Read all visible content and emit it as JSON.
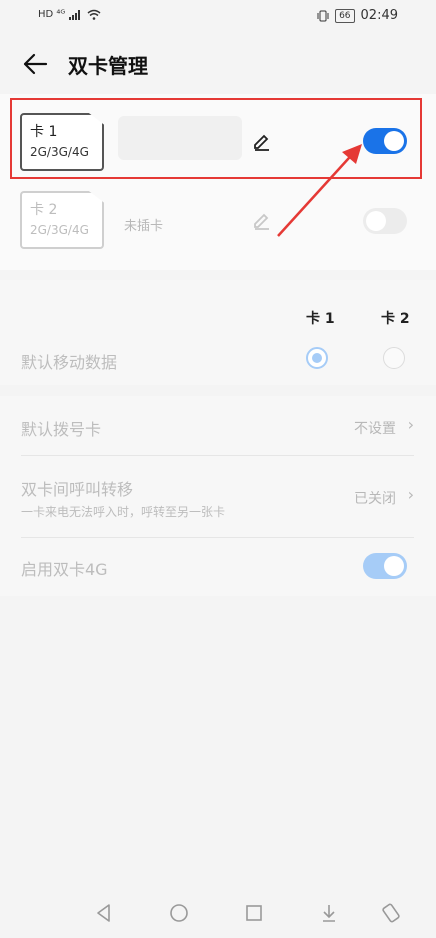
{
  "status_bar": {
    "left_indicators": "HD ⁴ᴳ",
    "battery": "66",
    "time": "02:49"
  },
  "header": {
    "title": "双卡管理"
  },
  "sim1": {
    "name": "卡 1",
    "type": "2G/3G/4G",
    "enabled": true
  },
  "sim2": {
    "name": "卡 2",
    "type": "2G/3G/4G",
    "status": "未插卡",
    "enabled": false
  },
  "mobile_data": {
    "col1": "卡 1",
    "col2": "卡 2",
    "label": "默认移动数据",
    "selected": "卡 1"
  },
  "settings": {
    "default_dial": {
      "label": "默认拨号卡",
      "value": "不设置"
    },
    "call_forward": {
      "label": "双卡间呼叫转移",
      "sub": "一卡来电无法呼入时，呼转至另一张卡",
      "value": "已关闭"
    },
    "dual_4g": {
      "label": "启用双卡4G",
      "enabled": true
    }
  },
  "colors": {
    "accent": "#1a73e8",
    "accent_light": "#a6ccf7",
    "highlight": "#e53935"
  }
}
